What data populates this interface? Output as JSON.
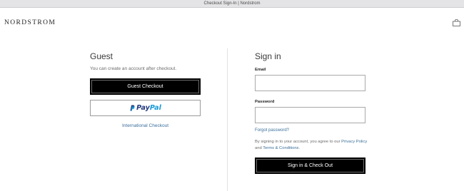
{
  "window": {
    "title": "Checkout Sign-In | Nordstrom"
  },
  "header": {
    "logo": "NORDSTROM",
    "bag_icon": "shopping-bag-icon"
  },
  "guest": {
    "title": "Guest",
    "subtext": "You can create an account after checkout.",
    "checkout_button": "Guest Checkout",
    "paypal_part1": "Pay",
    "paypal_part2": "Pal",
    "international_link": "International Checkout"
  },
  "signin": {
    "title": "Sign in",
    "email_label": "Email",
    "email_value": "",
    "password_label": "Password",
    "password_value": "",
    "forgot_link": "Forgot password?",
    "terms_prefix": "By signing in to your account, you agree to our ",
    "privacy_link": "Privacy Policy",
    "terms_and": " and ",
    "terms_link": "Terms & Conditions",
    "terms_suffix": ".",
    "submit_button": "Sign in & Check Out"
  },
  "colors": {
    "link": "#3a6f9c",
    "button_bg": "#000000",
    "paypal_dark": "#253b80",
    "paypal_light": "#179bd7"
  }
}
